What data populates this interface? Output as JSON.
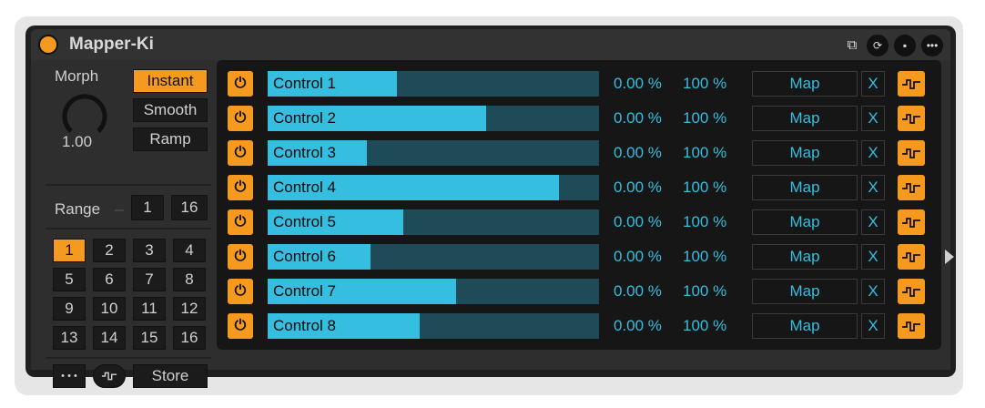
{
  "device": {
    "title": "Mapper-Ki"
  },
  "left": {
    "morph_label": "Morph",
    "morph_value": "1.00",
    "mode_buttons": [
      {
        "label": "Instant",
        "active": true
      },
      {
        "label": "Smooth",
        "active": false
      },
      {
        "label": "Ramp",
        "active": false
      }
    ],
    "range_label": "Range",
    "range_min": "1",
    "range_max": "16",
    "grid": [
      "1",
      "2",
      "3",
      "4",
      "5",
      "6",
      "7",
      "8",
      "9",
      "10",
      "11",
      "12",
      "13",
      "14",
      "15",
      "16"
    ],
    "selected_slot": "1",
    "more_label": "• • •",
    "store_label": "Store"
  },
  "controls": [
    {
      "name": "Control 1",
      "fill": 0.39,
      "min": "0.00 %",
      "max": "100 %",
      "map": "Map",
      "x": "X"
    },
    {
      "name": "Control 2",
      "fill": 0.66,
      "min": "0.00 %",
      "max": "100 %",
      "map": "Map",
      "x": "X"
    },
    {
      "name": "Control 3",
      "fill": 0.3,
      "min": "0.00 %",
      "max": "100 %",
      "map": "Map",
      "x": "X"
    },
    {
      "name": "Control 4",
      "fill": 0.88,
      "min": "0.00 %",
      "max": "100 %",
      "map": "Map",
      "x": "X"
    },
    {
      "name": "Control 5",
      "fill": 0.41,
      "min": "0.00 %",
      "max": "100 %",
      "map": "Map",
      "x": "X"
    },
    {
      "name": "Control 6",
      "fill": 0.31,
      "min": "0.00 %",
      "max": "100 %",
      "map": "Map",
      "x": "X"
    },
    {
      "name": "Control 7",
      "fill": 0.57,
      "min": "0.00 %",
      "max": "100 %",
      "map": "Map",
      "x": "X"
    },
    {
      "name": "Control 8",
      "fill": 0.46,
      "min": "0.00 %",
      "max": "100 %",
      "map": "Map",
      "x": "X"
    }
  ],
  "colors": {
    "accent": "#f59a1e",
    "cyan": "#35bedf",
    "bar_bg": "#1f4a57"
  }
}
